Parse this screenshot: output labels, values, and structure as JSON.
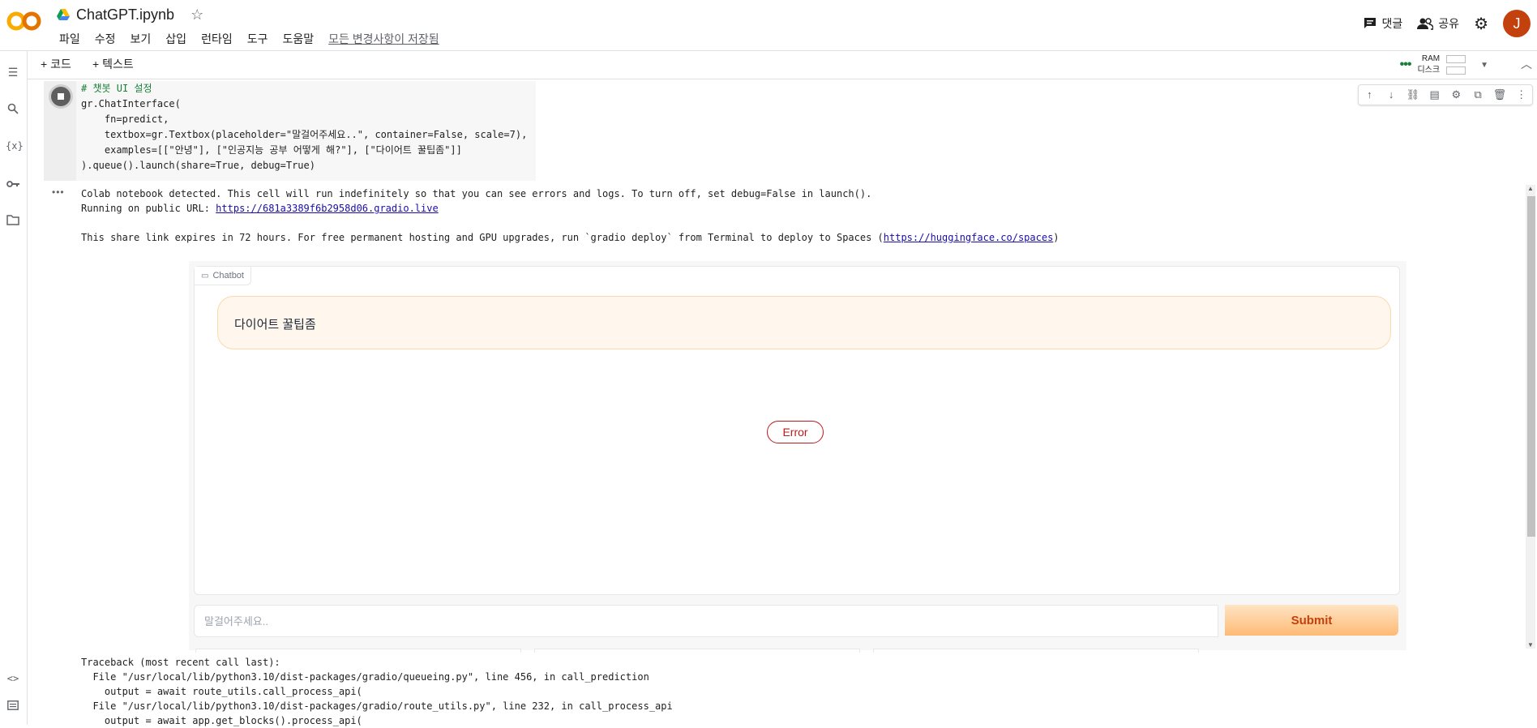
{
  "app": {
    "title": "ChatGPT.ipynb",
    "menu": [
      "파일",
      "수정",
      "보기",
      "삽입",
      "런타임",
      "도구",
      "도움말"
    ],
    "saved_status": "모든 변경사항이 저장됨",
    "comment_label": "댓글",
    "share_label": "공유",
    "avatar_letter": "J",
    "logo_text": "CO"
  },
  "toolbar": {
    "add_code": "+ 코드",
    "add_text": "+ 텍스트",
    "ram_label": "RAM",
    "disk_label": "디스크"
  },
  "cell": {
    "code_lines": [
      "# 챗봇 UI 설정",
      "gr.ChatInterface(",
      "    fn=predict,",
      "    textbox=gr.Textbox(placeholder=\"말걸어주세요..\", container=False, scale=7),",
      "    examples=[[\"안녕\"], [\"인공지능 공부 어떻게 해?\"], [\"다이어트 꿀팁좀\"]]",
      ").queue().launch(share=True, debug=True)"
    ]
  },
  "output": {
    "line1": "Colab notebook detected. This cell will run indefinitely so that you can see errors and logs. To turn off, set debug=False in launch().",
    "line2_prefix": "Running on public URL: ",
    "line2_link": "https://681a3389f6b2958d06.gradio.live",
    "line3_prefix": "This share link expires in 72 hours. For free permanent hosting and GPU upgrades, run `gradio deploy` from Terminal to deploy to Spaces (",
    "line3_link": "https://huggingface.co/spaces",
    "line3_suffix": ")"
  },
  "gradio": {
    "chatbot_label": "Chatbot",
    "user_message": "다이어트 꿀팁좀",
    "error_label": "Error",
    "input_placeholder": "말걸어주세요..",
    "submit_label": "Submit"
  },
  "traceback": {
    "lines": [
      "Traceback (most recent call last):",
      "  File \"/usr/local/lib/python3.10/dist-packages/gradio/queueing.py\", line 456, in call_prediction",
      "    output = await route_utils.call_process_api(",
      "  File \"/usr/local/lib/python3.10/dist-packages/gradio/route_utils.py\", line 232, in call_process_api",
      "    output = await app.get_blocks().process_api("
    ]
  },
  "colors": {
    "accent_orange": "#f9ab00",
    "error_red": "#b91c1c",
    "submit_text": "#c2410c"
  }
}
